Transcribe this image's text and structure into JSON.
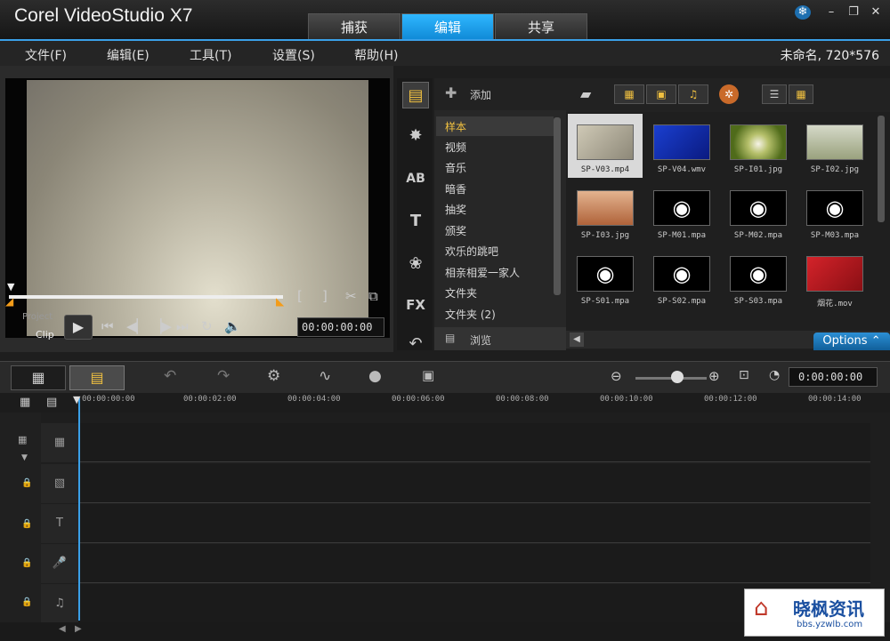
{
  "app": {
    "title": "Corel VideoStudio X7"
  },
  "tabs": [
    {
      "label": "捕获"
    },
    {
      "label": "编辑"
    },
    {
      "label": "共享"
    }
  ],
  "menu": [
    {
      "label": "文件(F)"
    },
    {
      "label": "编辑(E)"
    },
    {
      "label": "工具(T)"
    },
    {
      "label": "设置(S)"
    },
    {
      "label": "帮助(H)"
    }
  ],
  "project_info": "未命名, 720*576",
  "player": {
    "mode_project": "Project",
    "mode_clip": "Clip",
    "timecode": "00:00:00:00",
    "trim_start": "[",
    "trim_end": "]"
  },
  "library": {
    "add_label": "添加",
    "folders": [
      "样本",
      "视频",
      "音乐",
      "暗香",
      "抽奖",
      "颁奖",
      "欢乐的跳吧",
      "相亲相爱一家人",
      "文件夹",
      "文件夹 (2)"
    ],
    "browse_label": "浏览",
    "items": [
      {
        "name": "SP-V03.mp4",
        "kind": "video-warm"
      },
      {
        "name": "SP-V04.wmv",
        "kind": "video-blue"
      },
      {
        "name": "SP-I01.jpg",
        "kind": "image-dandelion"
      },
      {
        "name": "SP-I02.jpg",
        "kind": "image-tree"
      },
      {
        "name": "SP-I03.jpg",
        "kind": "image-desert"
      },
      {
        "name": "SP-M01.mpa",
        "kind": "music"
      },
      {
        "name": "SP-M02.mpa",
        "kind": "music"
      },
      {
        "name": "SP-M03.mpa",
        "kind": "music"
      },
      {
        "name": "SP-S01.mpa",
        "kind": "music"
      },
      {
        "name": "SP-S02.mpa",
        "kind": "music"
      },
      {
        "name": "SP-S03.mpa",
        "kind": "music"
      },
      {
        "name": "烟花.mov",
        "kind": "video-red"
      }
    ],
    "options_label": "Options"
  },
  "timeline": {
    "timecode": "0:00:00:00",
    "ticks": [
      "00:00:00:00",
      "00:00:02:00",
      "00:00:04:00",
      "00:00:06:00",
      "00:00:08:00",
      "00:00:10:00",
      "00:00:12:00",
      "00:00:14:00"
    ]
  },
  "watermark": {
    "text": "晓枫资讯",
    "url": "bbs.yzwlb.com"
  },
  "colors": {
    "accent": "#1a9ee8",
    "active_tab": "#2fb7ff"
  }
}
